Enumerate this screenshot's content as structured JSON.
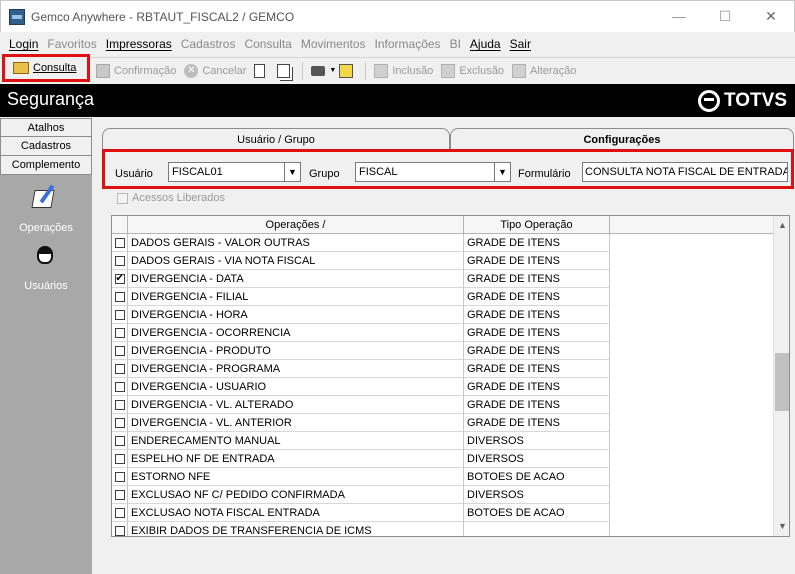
{
  "window": {
    "title": "Gemco Anywhere - RBTAUT_FISCAL2 / GEMCO"
  },
  "menu": [
    {
      "label": "Login",
      "enabled": true
    },
    {
      "label": "Favoritos",
      "enabled": false
    },
    {
      "label": "Impressoras",
      "enabled": true
    },
    {
      "label": "Cadastros",
      "enabled": false
    },
    {
      "label": "Consulta",
      "enabled": false
    },
    {
      "label": "Movimentos",
      "enabled": false
    },
    {
      "label": "Informações",
      "enabled": false
    },
    {
      "label": "BI",
      "enabled": false
    },
    {
      "label": "Ajuda",
      "enabled": true
    },
    {
      "label": "Sair",
      "enabled": true
    }
  ],
  "toolbar": {
    "consulta": "Consulta",
    "confirmacao": "Confirmação",
    "cancelar": "Cancelar",
    "inclusao": "Inclusão",
    "exclusao": "Exclusão",
    "alteracao": "Alteração"
  },
  "header": {
    "title": "Segurança",
    "logo": "TOTVS"
  },
  "left_nav": {
    "tabs": [
      "Atalhos",
      "Cadastros",
      "Complemento"
    ],
    "links": [
      "Operações",
      "Usuários"
    ]
  },
  "tabs": {
    "usuario_grupo": "Usuário  / Grupo",
    "configuracoes": "Configurações"
  },
  "filters": {
    "usuario_label": "Usuário",
    "usuario_value": "FISCAL01",
    "grupo_label": "Grupo",
    "grupo_value": "FISCAL",
    "formulario_label": "Formulário",
    "formulario_value": "CONSULTA NOTA FISCAL DE ENTRADA"
  },
  "acessos_liberados": "Acessos Liberados",
  "grid": {
    "headers": {
      "operacoes": "Operações  /",
      "tipo": "Tipo Operação"
    },
    "rows": [
      {
        "op": "DADOS GERAIS - VALOR OUTRAS",
        "tipo": "GRADE DE ITENS",
        "checked": false
      },
      {
        "op": "DADOS GERAIS - VIA NOTA FISCAL",
        "tipo": "GRADE DE ITENS",
        "checked": false
      },
      {
        "op": "DIVERGENCIA - DATA",
        "tipo": "GRADE DE ITENS",
        "checked": true
      },
      {
        "op": "DIVERGENCIA - FILIAL",
        "tipo": "GRADE DE ITENS",
        "checked": false
      },
      {
        "op": "DIVERGENCIA - HORA",
        "tipo": "GRADE DE ITENS",
        "checked": false
      },
      {
        "op": "DIVERGENCIA - OCORRENCIA",
        "tipo": "GRADE DE ITENS",
        "checked": false
      },
      {
        "op": "DIVERGENCIA - PRODUTO",
        "tipo": "GRADE DE ITENS",
        "checked": false
      },
      {
        "op": "DIVERGENCIA - PROGRAMA",
        "tipo": "GRADE DE ITENS",
        "checked": false
      },
      {
        "op": "DIVERGENCIA - USUARIO",
        "tipo": "GRADE DE ITENS",
        "checked": false
      },
      {
        "op": "DIVERGENCIA - VL. ALTERADO",
        "tipo": "GRADE DE ITENS",
        "checked": false
      },
      {
        "op": "DIVERGENCIA - VL. ANTERIOR",
        "tipo": "GRADE DE ITENS",
        "checked": false
      },
      {
        "op": "ENDERECAMENTO MANUAL",
        "tipo": "DIVERSOS",
        "checked": false
      },
      {
        "op": "ESPELHO NF DE ENTRADA",
        "tipo": "DIVERSOS",
        "checked": false
      },
      {
        "op": "ESTORNO NFE",
        "tipo": "BOTOES DE ACAO",
        "checked": false
      },
      {
        "op": "EXCLUSAO NF C/ PEDIDO CONFIRMADA",
        "tipo": "DIVERSOS",
        "checked": false
      },
      {
        "op": "EXCLUSAO NOTA FISCAL ENTRADA",
        "tipo": "BOTOES DE ACAO",
        "checked": false
      },
      {
        "op": "EXIBIR DADOS DE TRANSFERENCIA DE ICMS",
        "tipo": "",
        "checked": false
      }
    ]
  }
}
